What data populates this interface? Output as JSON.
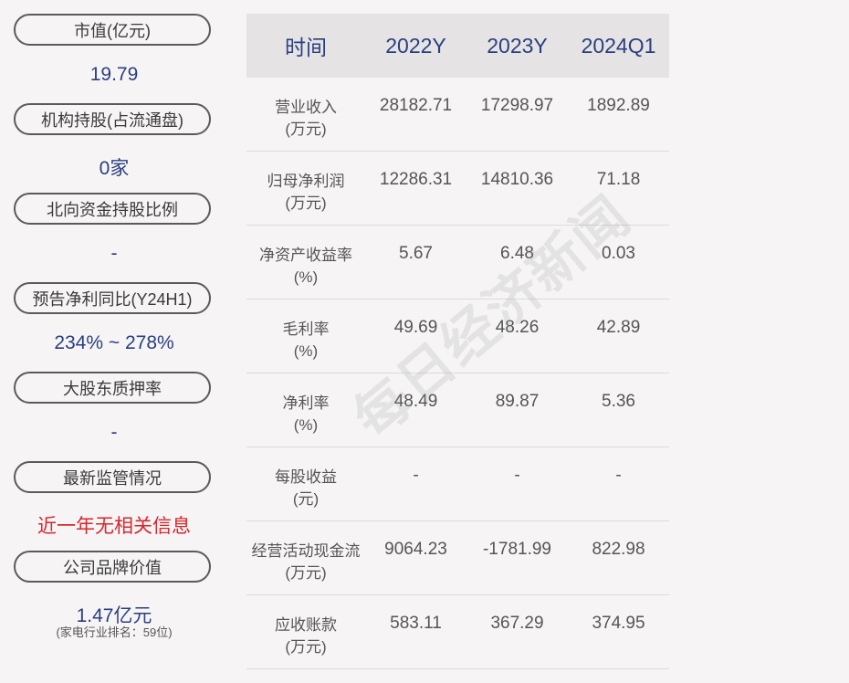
{
  "left_panel": {
    "items": [
      {
        "label": "市值(亿元)",
        "value": "19.79"
      },
      {
        "label": "机构持股(占流通盘)",
        "value": "0家"
      },
      {
        "label": "北向资金持股比例",
        "value": "-"
      },
      {
        "label": "预告净利同比(Y24H1)",
        "value": "234% ~ 278%"
      },
      {
        "label": "大股东质押率",
        "value": "-"
      },
      {
        "label": "最新监管情况",
        "value": "近一年无相关信息"
      },
      {
        "label": "公司品牌价值",
        "value": "1.47亿元",
        "note": "(家电行业排名：59位)"
      }
    ],
    "colors": {
      "value": "#2a3f7e",
      "alert": "#d7272c"
    }
  },
  "table": {
    "headers": [
      "时间",
      "2022Y",
      "2023Y",
      "2024Q1"
    ],
    "rows": [
      {
        "name": "营业收入",
        "unit": "(万元)",
        "values": [
          "28182.71",
          "17298.97",
          "1892.89"
        ]
      },
      {
        "name": "归母净利润",
        "unit": "(万元)",
        "values": [
          "12286.31",
          "14810.36",
          "71.18"
        ]
      },
      {
        "name": "净资产收益率",
        "unit": "(%)",
        "values": [
          "5.67",
          "6.48",
          "0.03"
        ]
      },
      {
        "name": "毛利率",
        "unit": "(%)",
        "values": [
          "49.69",
          "48.26",
          "42.89"
        ]
      },
      {
        "name": "净利率",
        "unit": "(%)",
        "values": [
          "48.49",
          "89.87",
          "5.36"
        ]
      },
      {
        "name": "每股收益",
        "unit": "(元)",
        "values": [
          "-",
          "-",
          "-"
        ]
      },
      {
        "name": "经营活动现金流",
        "unit": "(万元)",
        "values": [
          "9064.23",
          "-1781.99",
          "822.98"
        ]
      },
      {
        "name": "应收账款",
        "unit": "(万元)",
        "values": [
          "583.11",
          "367.29",
          "374.95"
        ]
      }
    ]
  },
  "watermark": "每日经济新闻"
}
